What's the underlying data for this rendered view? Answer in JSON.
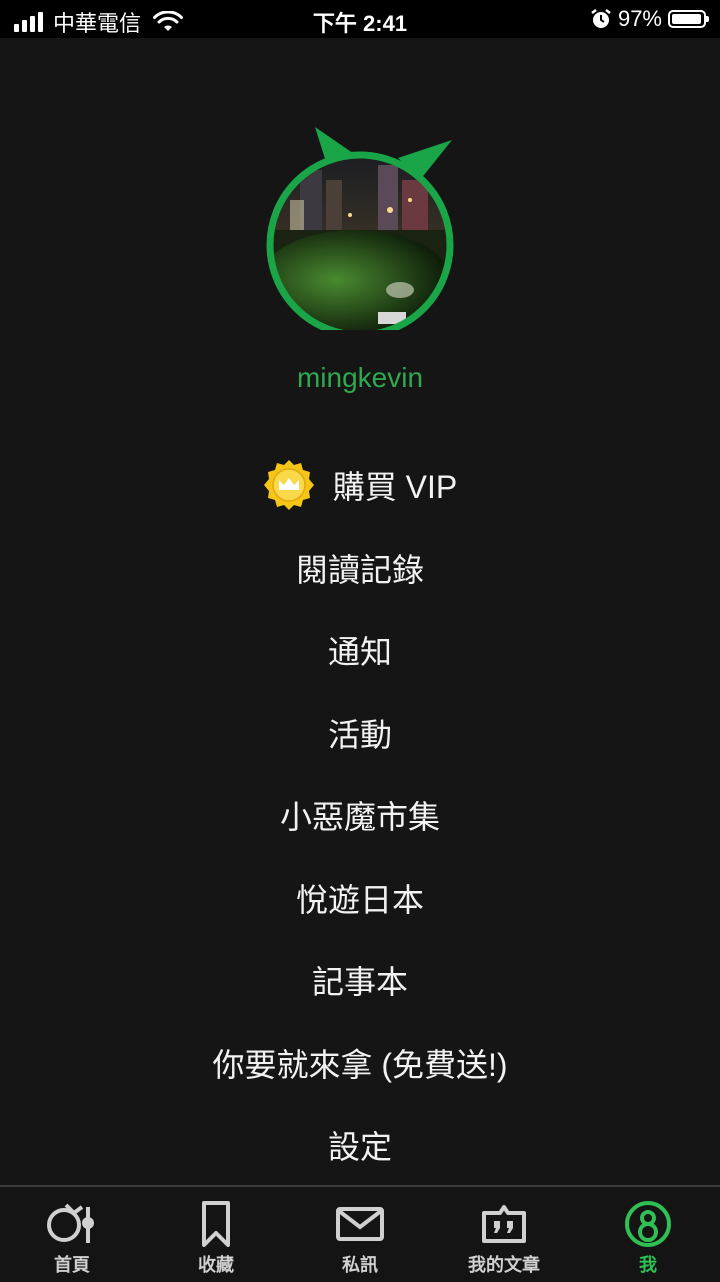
{
  "status_bar": {
    "carrier": "中華電信",
    "time": "下午 2:41",
    "battery": "97%"
  },
  "profile": {
    "username": "mingkevin"
  },
  "colors": {
    "accent": "#2fa84f",
    "background": "#151515",
    "vip_gold": "#f5c518"
  },
  "menu": [
    {
      "label": "購買 VIP",
      "icon": "crown-badge-icon"
    },
    {
      "label": "閱讀記錄"
    },
    {
      "label": "通知"
    },
    {
      "label": "活動"
    },
    {
      "label": "小惡魔市集"
    },
    {
      "label": "悅遊日本"
    },
    {
      "label": "記事本"
    },
    {
      "label": "你要就來拿 (免費送!)"
    },
    {
      "label": "設定"
    }
  ],
  "tabs": [
    {
      "label": "首頁",
      "icon": "home-logo-icon"
    },
    {
      "label": "收藏",
      "icon": "bookmark-icon"
    },
    {
      "label": "私訊",
      "icon": "mail-icon"
    },
    {
      "label": "我的文章",
      "icon": "quote-icon"
    },
    {
      "label": "我",
      "icon": "profile-icon",
      "active": true
    }
  ]
}
